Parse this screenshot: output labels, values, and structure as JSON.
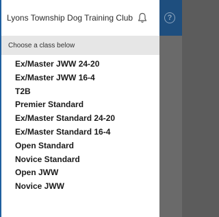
{
  "header": {
    "app_title": "Lyons Township Dog Training Club",
    "help_glyph": "?",
    "icons": {
      "notifications": "bell-icon",
      "help": "help-icon"
    }
  },
  "drawer": {
    "subheader": "Choose a class below",
    "classes": [
      "Ex/Master JWW 24-20",
      "Ex/Master JWW 16-4",
      "T2B",
      "Premier Standard",
      "Ex/Master Standard 24-20",
      "Ex/Master Standard 16-4",
      "Open Standard",
      "Novice Standard",
      "Open JWW",
      "Novice JWW"
    ]
  },
  "colors": {
    "header_bg": "#1e4e7e",
    "overlay": "#5c5c5c",
    "drawer_accent": "#1f5f9f",
    "subheader_bg": "#e6e6e6"
  }
}
